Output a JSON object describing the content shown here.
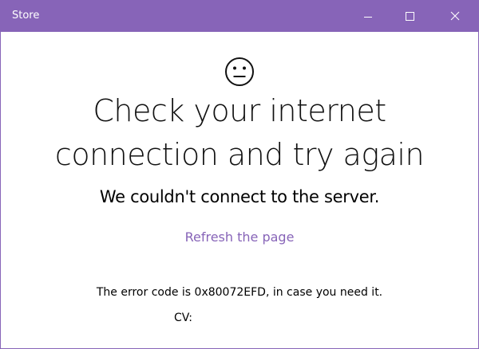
{
  "window": {
    "title": "Store",
    "accent_color": "#8764b8"
  },
  "icons": {
    "face": "neutral-face-icon",
    "minimize": "minimize-icon",
    "maximize": "maximize-icon",
    "close": "close-icon"
  },
  "message": {
    "headline_line1": "Check your internet",
    "headline_line2": "connection and try again",
    "subhead": "We couldn't connect to the server.",
    "refresh_link": "Refresh the page",
    "error_code_text": "The error code is 0x80072EFD, in case you need it.",
    "cv_label": "CV:"
  }
}
